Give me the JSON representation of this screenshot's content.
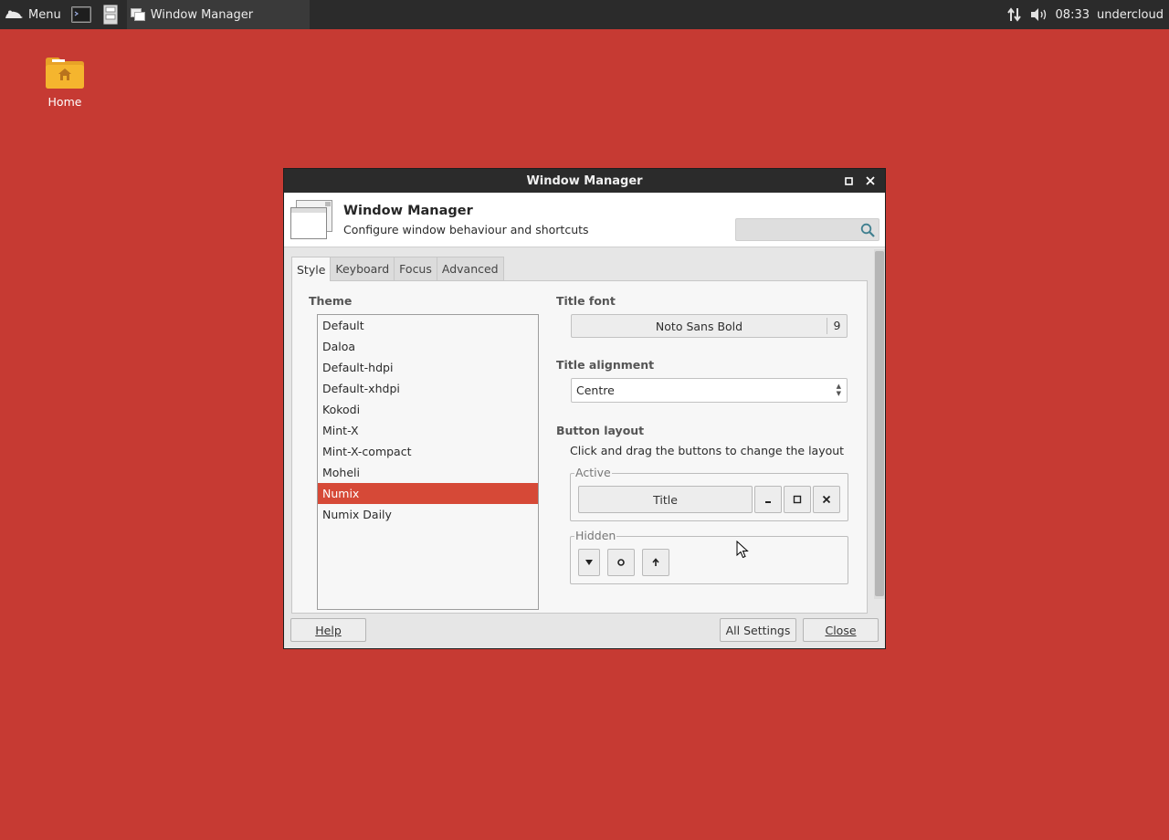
{
  "panel": {
    "menu_label": "Menu",
    "task_title": "Window Manager",
    "clock": "08:33",
    "user": "undercloud"
  },
  "desktop": {
    "home_label": "Home"
  },
  "window": {
    "title": "Window Manager",
    "header_title": "Window Manager",
    "header_subtitle": "Configure window behaviour and shortcuts",
    "search_placeholder": "",
    "tabs": [
      {
        "label": "Style",
        "active": true
      },
      {
        "label": "Keyboard",
        "active": false
      },
      {
        "label": "Focus",
        "active": false
      },
      {
        "label": "Advanced",
        "active": false
      }
    ],
    "style": {
      "theme_label": "Theme",
      "themes": [
        "Default",
        "Daloa",
        "Default-hdpi",
        "Default-xhdpi",
        "Kokodi",
        "Mint-X",
        "Mint-X-compact",
        "Moheli",
        "Numix",
        "Numix Daily"
      ],
      "selected_theme": "Numix",
      "title_font_label": "Title font",
      "title_font_name": "Noto Sans Bold",
      "title_font_size": "9",
      "title_alignment_label": "Title alignment",
      "title_alignment_value": "Centre",
      "button_layout_label": "Button layout",
      "button_layout_hint": "Click and drag the buttons to change the layout",
      "active_label": "Active",
      "active_title_button": "Title",
      "hidden_label": "Hidden"
    },
    "buttons": {
      "help": "Help",
      "all_settings": "All Settings",
      "close": "Close"
    }
  },
  "colors": {
    "desktop_bg": "#c63a33",
    "panel_bg": "#2b2b2b",
    "selection": "#d64937"
  }
}
